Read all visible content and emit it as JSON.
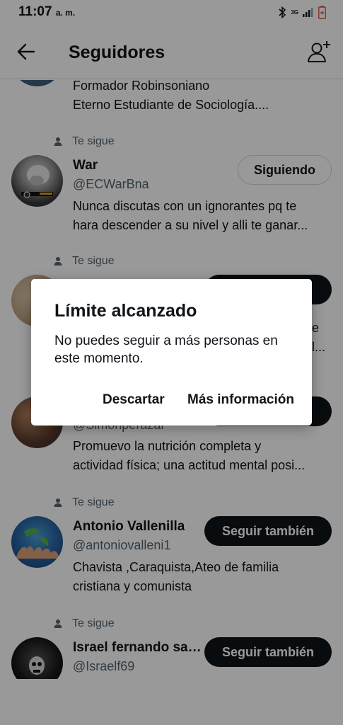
{
  "status": {
    "time": "11:07",
    "ampm": "a. m.",
    "network": "3G"
  },
  "header": {
    "title": "Seguidores"
  },
  "follows_you_label": "Te sigue",
  "users": [
    {
      "name": "",
      "handle": "",
      "bio": [
        "Formador Robinsoniano",
        "Eterno Estudiante de Sociología...."
      ],
      "button": "",
      "follows_you": false
    },
    {
      "name": "War",
      "handle": "@ECWarBna",
      "bio": [
        "Nunca discutas con un ignorantes pq te",
        "hara descender a su nivel y alli te ganar..."
      ],
      "button": "Siguiendo",
      "follows_you": true
    },
    {
      "name": "",
      "handle": "",
      "bio": [
        "",
        ""
      ],
      "button": "",
      "follows_you": true,
      "partial_bio_end": [
        "te",
        "e l..."
      ]
    },
    {
      "name": "",
      "handle": "@Simonperazar",
      "bio": [
        "Promuevo la nutrición completa y",
        "actividad física; una actitud mental posi..."
      ],
      "button": "",
      "follows_you": false
    },
    {
      "name": "Antonio Vallenilla",
      "handle": "@antoniovalleni1",
      "bio": [
        "Chavista ,Caraquista,Ateo  de  familia",
        "cristiana  y  comunista"
      ],
      "button": "Seguir también",
      "follows_you": true
    },
    {
      "name": "Israel fernando sal...",
      "handle": "@Israelf69",
      "bio": [],
      "button": "Seguir también",
      "follows_you": true
    }
  ],
  "dialog": {
    "title": "Límite alcanzado",
    "message": "No puedes seguir a más personas en este momento.",
    "dismiss": "Descartar",
    "more_info": "Más información"
  },
  "colors": {
    "accent": "#0f1419",
    "secondary_text": "#536471",
    "border": "#cfd9de",
    "scrim": "rgba(0,0,0,0.40)"
  }
}
